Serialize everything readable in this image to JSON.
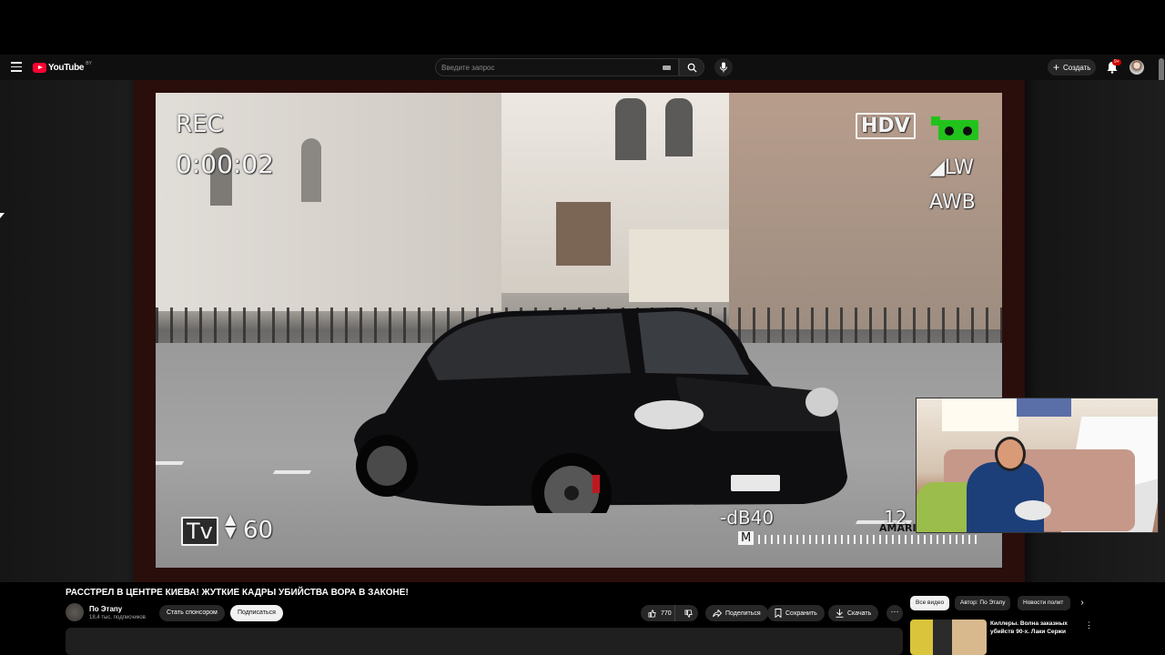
{
  "masthead": {
    "logo_text": "YouTube",
    "logo_country": "BY",
    "search_placeholder": "Введите запрос",
    "create_label": "Создать",
    "notification_badge": "9+"
  },
  "video": {
    "osd": {
      "rec": "REC",
      "timecode": "0:00:02",
      "format": "HDV",
      "lw": "LW",
      "awb": "AWB",
      "mode": "Tv",
      "shutter": "60",
      "db": "-dB40",
      "frame_no": "12",
      "m": "M"
    },
    "plate": "AMARI"
  },
  "info": {
    "title": "РАССТРЕЛ В ЦЕНТРЕ КИЕВА! ЖУТКИЕ КАДРЫ УБИЙСТВА ВОРА В ЗАКОНЕ!",
    "channel_name": "По Этапу",
    "subscribers": "18,4 тыс. подписчиков",
    "sponsor_label": "Стать спонсором",
    "subscribe_label": "Подписаться",
    "like_count": "770",
    "share_label": "Поделиться",
    "save_label": "Сохранить",
    "download_label": "Скачать",
    "more_label": "⋯"
  },
  "sidebar": {
    "chips": [
      "Все видео",
      "Автор: По Этапу",
      "Новости полит"
    ],
    "rec_title": "Киллеры. Волна заказных убийств 90-х. Лаки Сержи",
    "rec_more": "⋮"
  }
}
